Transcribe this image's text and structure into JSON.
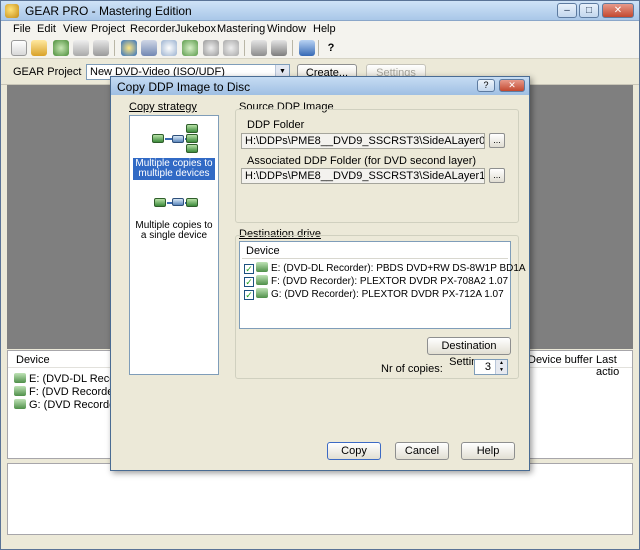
{
  "app": {
    "title": "GEAR PRO - Mastering Edition",
    "minimize": "–",
    "maximize": "□",
    "close": "✕"
  },
  "menu": [
    "File",
    "Edit",
    "View",
    "Project",
    "Recorder",
    "Jukebox",
    "Mastering",
    "Window",
    "Help"
  ],
  "project_bar": {
    "label": "GEAR Project",
    "selected": "New DVD-Video (ISO/UDF)",
    "create_label": "Create...",
    "settings_label": "Settings"
  },
  "device_panel": {
    "columns": [
      "Device",
      "Device buffer",
      "Last actio"
    ],
    "rows": [
      "E: (DVD-DL Recorder):",
      "F: (DVD Recorder):  PL",
      "G: (DVD Recorder):  PL"
    ]
  },
  "dialog": {
    "title": "Copy DDP Image to Disc",
    "help_btn": "?",
    "close_btn": "✕",
    "copy_strategy_label": "Copy strategy",
    "strategies": [
      {
        "label_line1": "Multiple copies to",
        "label_line2": "multiple devices",
        "selected": true
      },
      {
        "label_line1": "Multiple copies to",
        "label_line2": "a single device",
        "selected": false
      }
    ],
    "source_label": "Source DDP Image",
    "ddp_folder_label": "DDP Folder",
    "ddp_folder_value": "H:\\DDPs\\PME8__DVD9_SSCRST3\\SideALayer0",
    "assoc_folder_label": "Associated DDP Folder (for DVD second layer)",
    "assoc_folder_value": "H:\\DDPs\\PME8__DVD9_SSCRST3\\SideALayer1",
    "browse_label": "...",
    "dest_drive_label": "Destination drive",
    "device_header": "Device",
    "devices": [
      {
        "text": "E: (DVD-DL Recorder):  PBDS DVD+RW DS-8W1P BD1A",
        "checked": true
      },
      {
        "text": "F: (DVD Recorder):  PLEXTOR DVDR   PX-708A2 1.07",
        "checked": true
      },
      {
        "text": "G: (DVD Recorder):  PLEXTOR DVDR   PX-712A 1.07",
        "checked": true
      }
    ],
    "check_mark": "✓",
    "dest_settings_label": "Destination Settings",
    "nr_copies_label": "Nr of copies:",
    "nr_copies_value": "3",
    "copy_label": "Copy",
    "cancel_label": "Cancel",
    "help_label": "Help"
  }
}
